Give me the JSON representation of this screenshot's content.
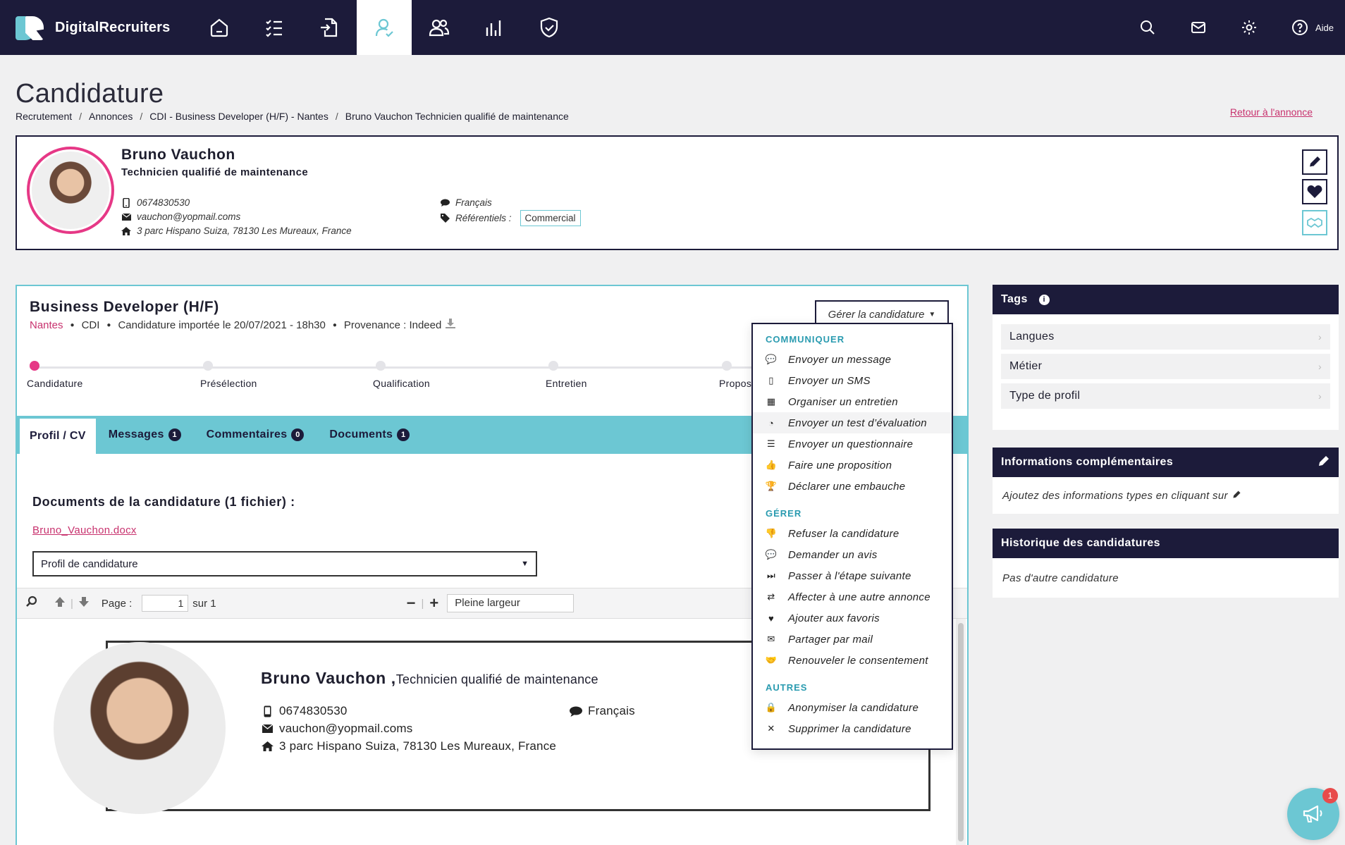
{
  "app": {
    "brand": "DigitalRecruiters",
    "help_label": "Aide"
  },
  "header": {
    "title": "Candidature",
    "breadcrumb": [
      "Recrutement",
      "Annonces",
      "CDI - Business Developer (H/F) - Nantes",
      "Bruno Vauchon Technicien qualifié de maintenance"
    ],
    "back_link": "Retour à l'annonce"
  },
  "candidate": {
    "name": "Bruno Vauchon",
    "job": "Technicien qualifié de maintenance",
    "phone": "0674830530",
    "email": "vauchon@yopmail.coms",
    "address": "3 parc Hispano Suiza, 78130 Les Mureaux, France",
    "language": "Français",
    "referentials_label": "Référentiels :",
    "referential_tag": "Commercial"
  },
  "application": {
    "title": "Business Developer (H/F)",
    "location": "Nantes",
    "contract": "CDI",
    "imported": "Candidature importée le 20/07/2021 - 18h30",
    "source": "Provenance : Indeed",
    "manage_label": "Gérer la candidature",
    "steps": [
      "Candidature",
      "Présélection",
      "Qualification",
      "Entretien",
      "Propos"
    ],
    "active_step": 0,
    "tabs": [
      {
        "label": "Profil / CV",
        "badge": ""
      },
      {
        "label": "Messages",
        "badge": "1"
      },
      {
        "label": "Commentaires",
        "badge": "0"
      },
      {
        "label": "Documents",
        "badge": "1"
      }
    ],
    "docs_title": "Documents de la candidature (1 fichier) :",
    "doc_file": "Bruno_Vauchon.docx",
    "doc_select": "Profil de candidature",
    "viewer": {
      "page_label": "Page :",
      "page_value": "1",
      "of_label": "sur 1",
      "zoom": "Pleine largeur"
    },
    "cv": {
      "name": "Bruno Vauchon ,",
      "job": "Technicien qualifié de maintenance",
      "phone": "0674830530",
      "email": "vauchon@yopmail.coms",
      "address": "3 parc Hispano Suiza, 78130 Les Mureaux, France",
      "language": "Français"
    }
  },
  "menu": {
    "sections": [
      {
        "title": "COMMUNIQUER",
        "items": [
          {
            "label": "Envoyer un message",
            "icon": "comment-icon",
            "glyph": "💬"
          },
          {
            "label": "Envoyer un SMS",
            "icon": "mobile-icon",
            "glyph": "▯"
          },
          {
            "label": "Organiser un entretien",
            "icon": "calendar-icon",
            "glyph": "▦"
          },
          {
            "label": "Envoyer un test d’évaluation",
            "icon": "pie-chart-icon",
            "glyph": "◔"
          },
          {
            "label": "Envoyer un questionnaire",
            "icon": "list-icon",
            "glyph": "☰"
          },
          {
            "label": "Faire une proposition",
            "icon": "thumbs-up-icon",
            "glyph": "👍"
          },
          {
            "label": "Déclarer une embauche",
            "icon": "trophy-icon",
            "glyph": "🏆"
          }
        ]
      },
      {
        "title": "GÉRER",
        "items": [
          {
            "label": "Refuser la candidature",
            "icon": "thumbs-down-icon",
            "glyph": "👎"
          },
          {
            "label": "Demander un avis",
            "icon": "comment-icon",
            "glyph": "💬"
          },
          {
            "label": "Passer à l'étape suivante",
            "icon": "step-forward-icon",
            "glyph": "⏭"
          },
          {
            "label": "Affecter à une autre annonce",
            "icon": "exchange-icon",
            "glyph": "⇄"
          },
          {
            "label": "Ajouter aux favoris",
            "icon": "heart-icon",
            "glyph": "♥"
          },
          {
            "label": "Partager par mail",
            "icon": "envelope-icon",
            "glyph": "✉"
          },
          {
            "label": "Renouveler le consentement",
            "icon": "handshake-icon",
            "glyph": "🤝"
          }
        ]
      },
      {
        "title": "AUTRES",
        "items": [
          {
            "label": "Anonymiser la candidature",
            "icon": "lock-icon",
            "glyph": "🔒"
          },
          {
            "label": "Supprimer la candidature",
            "icon": "close-icon",
            "glyph": "✕"
          }
        ]
      }
    ],
    "hovered": "Envoyer un test d’évaluation"
  },
  "sidebar": {
    "tags_title": "Tags",
    "tag_items": [
      "Langues",
      "Métier",
      "Type de profil"
    ],
    "info_title": "Informations complémentaires",
    "info_text": "Ajoutez des informations types en cliquant sur",
    "history_title": "Historique des candidatures",
    "history_text": "Pas d'autre candidature"
  },
  "fab": {
    "badge": "1"
  },
  "colors": {
    "navy": "#1c1b3a",
    "teal": "#6cc7d3",
    "pink": "#e63886",
    "link": "#c8326e"
  }
}
